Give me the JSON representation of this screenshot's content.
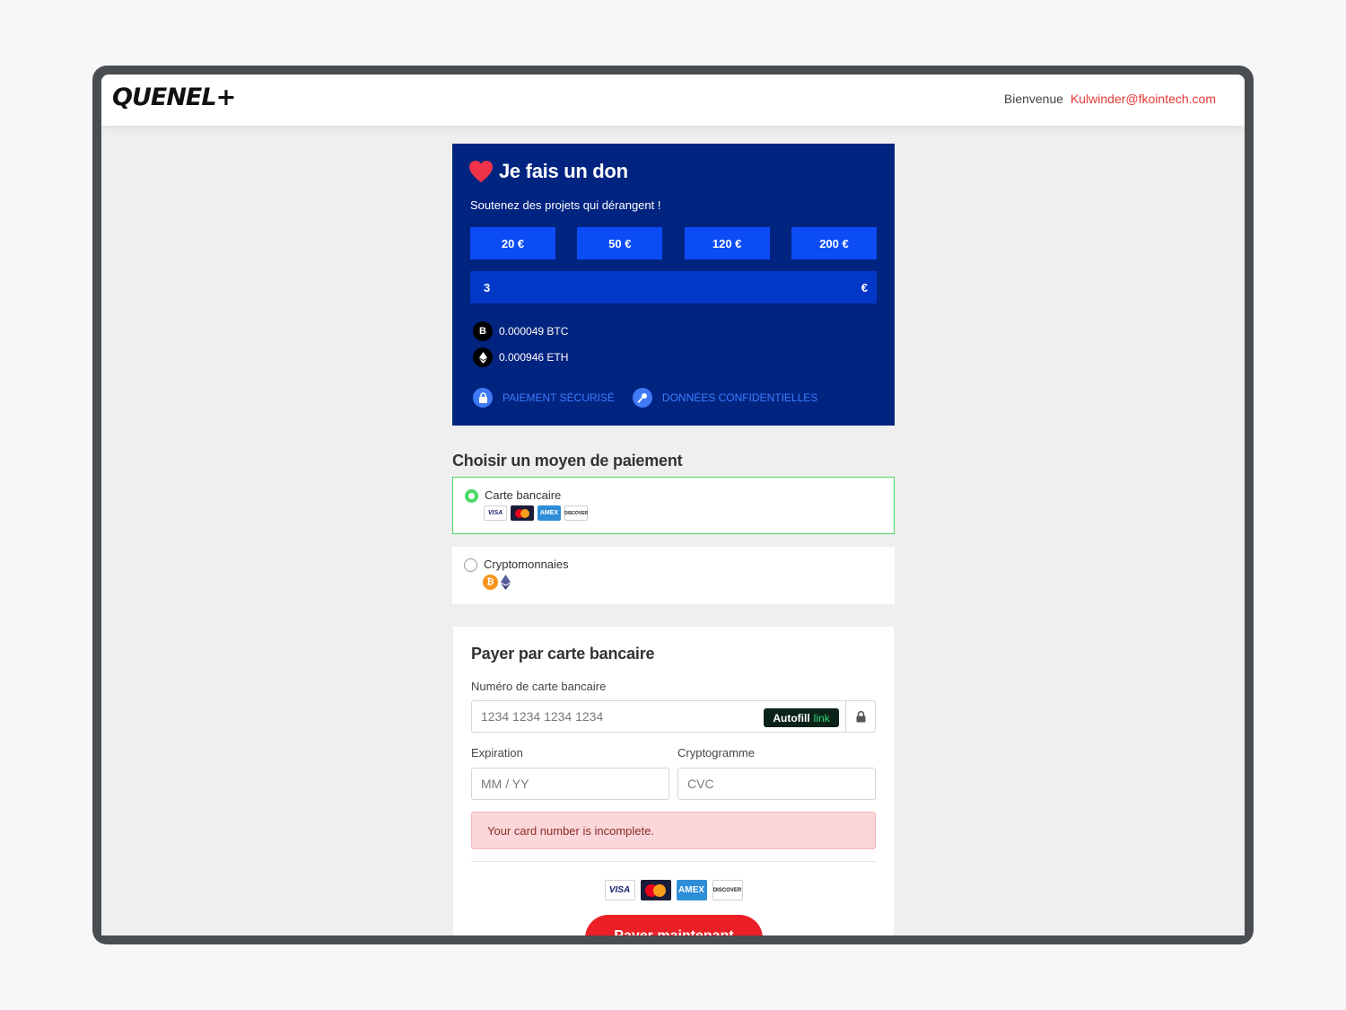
{
  "header": {
    "logo": "QUENEL+",
    "welcome_label": "Bienvenue",
    "user_email": "Kulwinder@fkointech.com"
  },
  "donation": {
    "title": "Je fais un don",
    "subtitle": "Soutenez des projets qui dérangent !",
    "amounts": [
      "20 €",
      "50 €",
      "120 €",
      "200 €"
    ],
    "custom_amount_value": "3",
    "currency_symbol": "€",
    "btc_symbol": "B",
    "btc_label": "0.000049 BTC",
    "eth_label": "0.000946 ETH",
    "secure_label": "PAIEMENT SÉCURISÉ",
    "confidential_label": "DONNÉES CONFIDENTIELLES",
    "accent_color": "#012480"
  },
  "payment_method": {
    "title": "Choisir un moyen de paiement",
    "options": [
      {
        "label": "Carte bancaire",
        "selected": true
      },
      {
        "label": "Cryptomonnaies",
        "selected": false
      }
    ],
    "crypto_btc_symbol": "₿"
  },
  "card_form": {
    "title": "Payer par carte bancaire",
    "card_number_label": "Numéro de carte bancaire",
    "card_number_placeholder": "1234 1234 1234 1234",
    "autofill_label": "Autofill",
    "autofill_link": "link",
    "expiration_label": "Expiration",
    "expiration_placeholder": "MM / YY",
    "cvc_label": "Cryptogramme",
    "cvc_placeholder": "CVC",
    "error_message": "Your card number is incomplete.",
    "pay_button": "Payer maintenant",
    "pay_button_color": "#ec1f27"
  },
  "card_brands": {
    "visa": "VISA",
    "amex": "AMEX",
    "discover": "DISCOVER"
  }
}
